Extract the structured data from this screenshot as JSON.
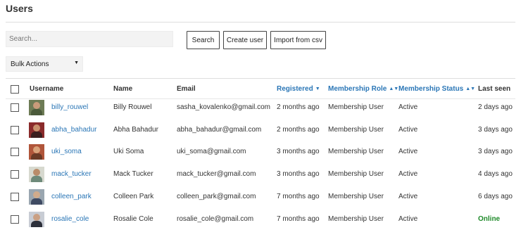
{
  "page": {
    "title": "Users"
  },
  "search": {
    "placeholder": "Search...",
    "value": ""
  },
  "buttons": {
    "search": "Search",
    "create_user": "Create user",
    "import_csv": "Import from csv"
  },
  "bulk_actions": {
    "selected": "Bulk Actions"
  },
  "table": {
    "columns": {
      "username": "Username",
      "name": "Name",
      "email": "Email",
      "registered": "Registered",
      "membership_role": "Membership Role",
      "membership_status": "Membership Status",
      "last_seen": "Last seen"
    },
    "rows": [
      {
        "username": "billy_rouwel",
        "name": "Billy Rouwel",
        "email": "sasha_kovalenko@gmail.com",
        "registered": "2 months ago",
        "role": "Membership User",
        "status": "Active",
        "last_seen": "2 days ago",
        "avatar_colors": [
          "#6d7b55",
          "#c99b7a",
          "#4b5a3a"
        ]
      },
      {
        "username": "abha_bahadur",
        "name": "Abha Bahadur",
        "email": "abha_bahadur@gmail.com",
        "registered": "2 months ago",
        "role": "Membership User",
        "status": "Active",
        "last_seen": "3 days ago",
        "avatar_colors": [
          "#8a2b2b",
          "#c9906c",
          "#3b1e1e"
        ]
      },
      {
        "username": "uki_soma",
        "name": "Uki Soma",
        "email": "uki_soma@gmail.com",
        "registered": "3 months ago",
        "role": "Membership User",
        "status": "Active",
        "last_seen": "3 days ago",
        "avatar_colors": [
          "#b0553a",
          "#d9a27a",
          "#6b3a26"
        ]
      },
      {
        "username": "mack_tucker",
        "name": "Mack Tucker",
        "email": "mack_tucker@gmail.com",
        "registered": "3 months ago",
        "role": "Membership User",
        "status": "Active",
        "last_seen": "4 days ago",
        "avatar_colors": [
          "#d7d9cf",
          "#b98c6a",
          "#6e8a7a"
        ]
      },
      {
        "username": "colleen_park",
        "name": "Colleen Park",
        "email": "colleen_park@gmail.com",
        "registered": "7 months ago",
        "role": "Membership User",
        "status": "Active",
        "last_seen": "6 days ago",
        "avatar_colors": [
          "#9aa6b0",
          "#d0ab8c",
          "#3f4b63"
        ]
      },
      {
        "username": "rosalie_cole",
        "name": "Rosalie Cole",
        "email": "rosalie_cole@gmail.com",
        "registered": "7 months ago",
        "role": "Membership User",
        "status": "Active",
        "last_seen": "Online",
        "avatar_colors": [
          "#c8ccd4",
          "#caa084",
          "#2c2f3a"
        ]
      }
    ]
  },
  "colors": {
    "link": "#2a76b6",
    "online": "#1f8a2a"
  }
}
